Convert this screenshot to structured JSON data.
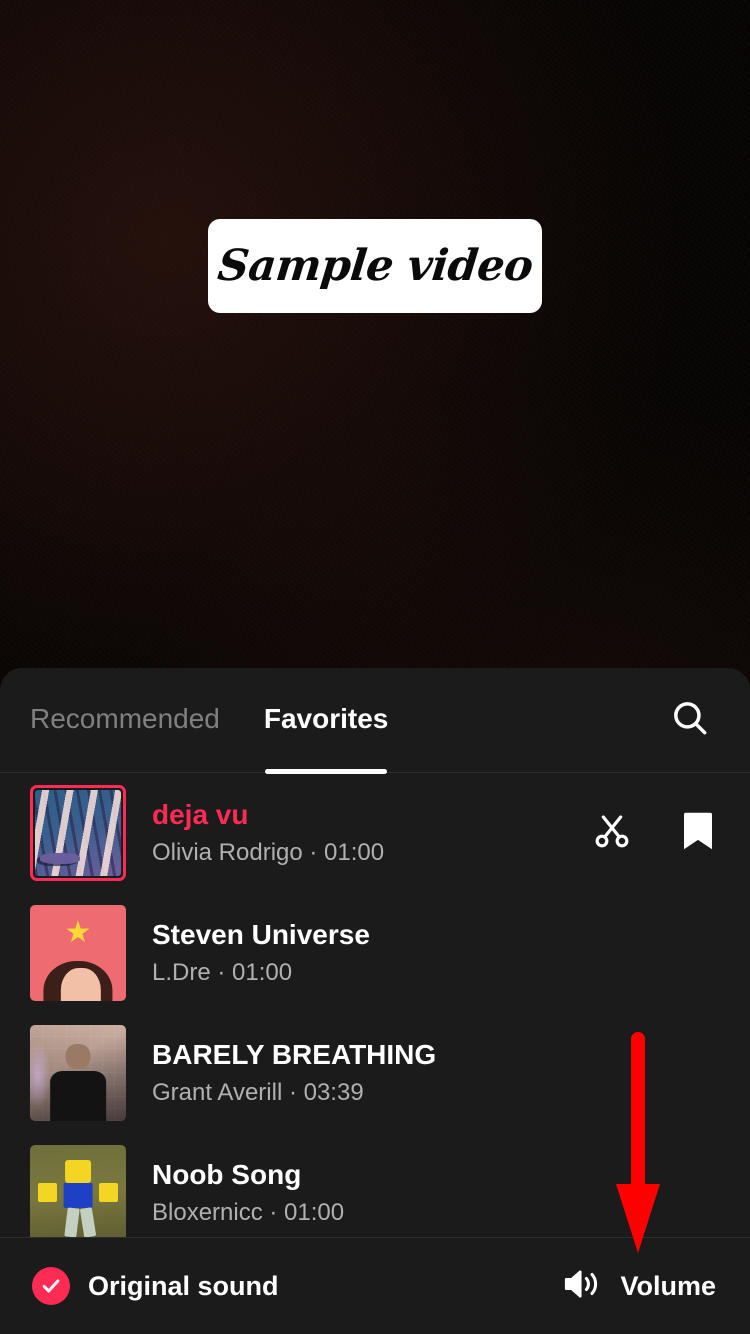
{
  "video": {
    "caption": "Sample video",
    "background_color": "#050403"
  },
  "music_panel": {
    "tabs": [
      {
        "label": "Recommended",
        "active": false
      },
      {
        "label": "Favorites",
        "active": true
      }
    ],
    "search_icon": "search-icon",
    "songs": [
      {
        "title": "deja vu",
        "artist": "Olivia Rodrigo",
        "separator": "·",
        "duration": "01:00",
        "subtitle": "Olivia Rodrigo · 01:00",
        "selected": true,
        "art": "dejavu",
        "actions": [
          "scissors-icon",
          "bookmark-icon"
        ]
      },
      {
        "title": "Steven Universe",
        "artist": "L.Dre",
        "separator": "·",
        "duration": "01:00",
        "subtitle": "L.Dre · 01:00",
        "selected": false,
        "art": "steven",
        "actions": []
      },
      {
        "title": "BARELY BREATHING",
        "artist": "Grant Averill",
        "separator": "·",
        "duration": "03:39",
        "subtitle": "Grant Averill · 03:39",
        "selected": false,
        "art": "barely",
        "actions": []
      },
      {
        "title": "Noob Song",
        "artist": "Bloxernicc",
        "separator": "·",
        "duration": "01:00",
        "subtitle": "Bloxernicc · 01:00",
        "selected": false,
        "art": "noob",
        "actions": []
      }
    ]
  },
  "bottom_bar": {
    "original_sound_label": "Original sound",
    "original_sound_checked": true,
    "volume_label": "Volume",
    "volume_icon": "speaker-waves-icon"
  },
  "annotation": {
    "type": "arrow-down",
    "color": "#FF0000",
    "points_to": "Volume"
  },
  "colors": {
    "accent_pink": "#FE2C55",
    "panel_bg": "#1B1B1B",
    "text_primary": "#FFFFFF",
    "text_secondary": "#B0B0B0",
    "tab_inactive": "#808080",
    "annotation_red": "#FF0000"
  }
}
